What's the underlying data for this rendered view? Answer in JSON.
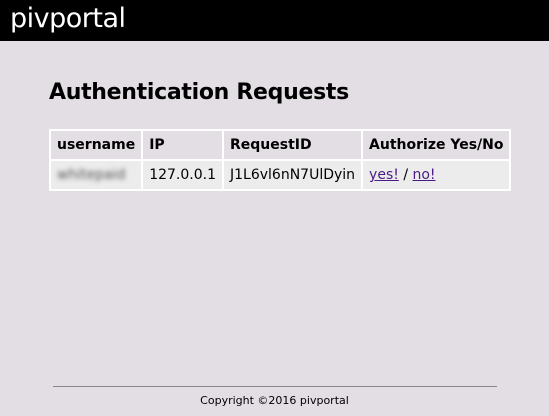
{
  "header": {
    "brand": "pivportal"
  },
  "main": {
    "title": "Authentication Requests",
    "table": {
      "columns": [
        "username",
        "IP",
        "RequestID",
        "Authorize Yes/No"
      ],
      "rows": [
        {
          "username": "whitepaid",
          "ip": "127.0.0.1",
          "request_id": "J1L6vl6nN7UlDyin",
          "yes_label": "yes!",
          "separator": "/",
          "no_label": "no!"
        }
      ]
    }
  },
  "footer": {
    "copyright": "Copyright ©2016 pivportal"
  },
  "colors": {
    "page_background": "#e3dde4",
    "topbar_background": "#000000",
    "link": "#4b1a86",
    "cell_background": "#ececec"
  }
}
